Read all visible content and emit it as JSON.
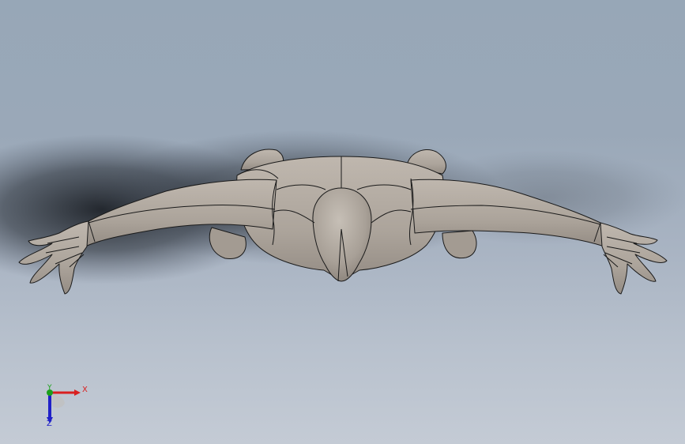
{
  "viewport": {
    "background_top": "#97a7b7",
    "background_bottom": "#c4cbd5",
    "shadow_color": "#1c2026"
  },
  "model": {
    "name": "human-figure-model",
    "surface_color": "#b2aaa1",
    "edge_color": "#1a1a1a",
    "view": "top"
  },
  "triad": {
    "x_label": "X",
    "y_label": "Y",
    "z_label": "Z",
    "x_color": "#d92020",
    "y_color": "#1ca01c",
    "z_color": "#2020c8"
  }
}
